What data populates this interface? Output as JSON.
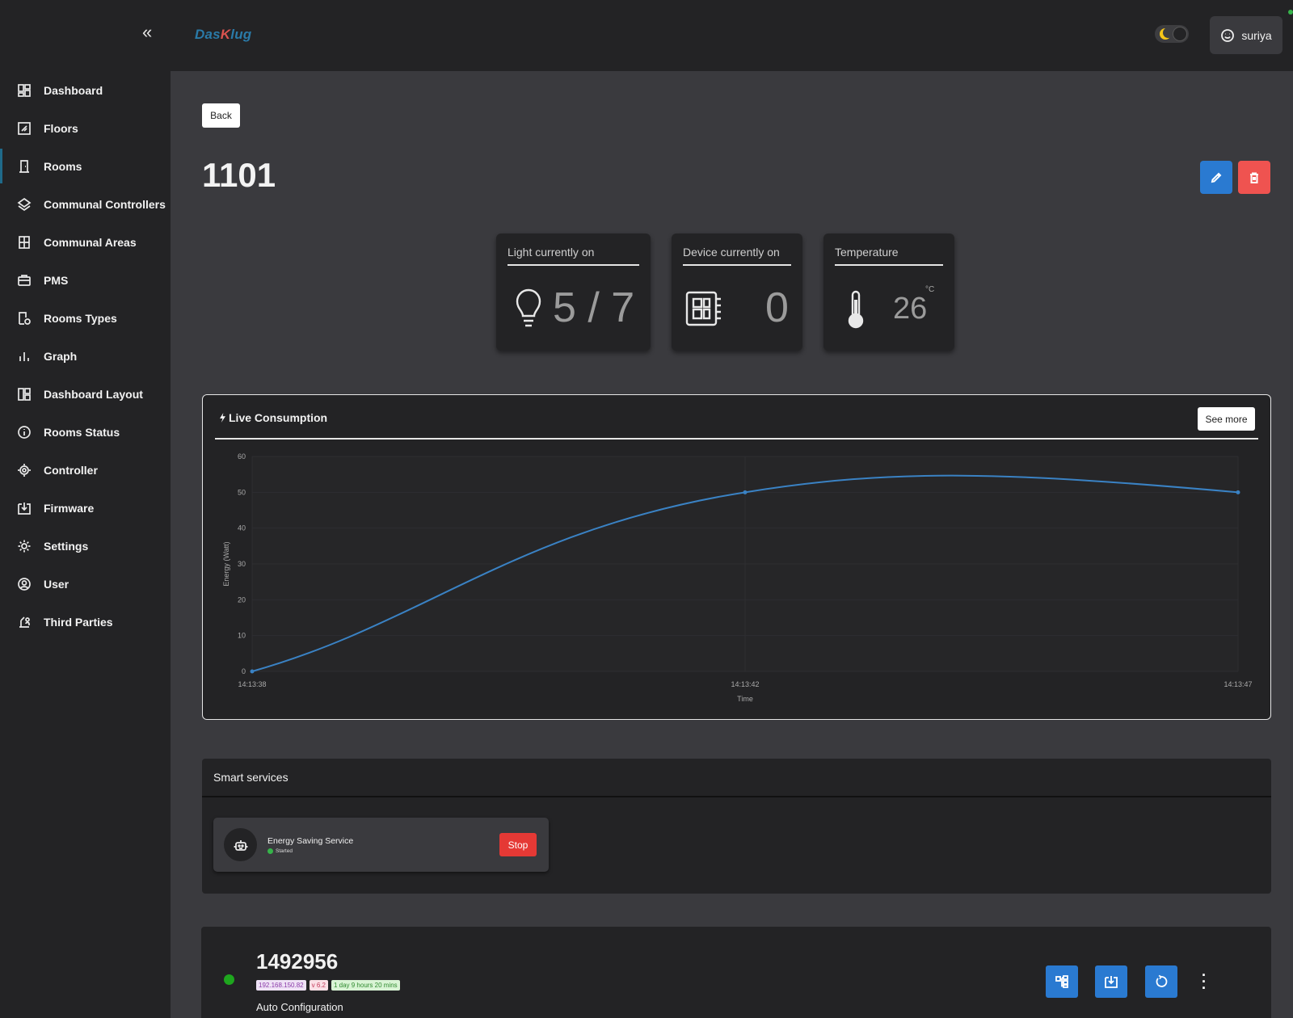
{
  "app": {
    "logo_main": "Das",
    "logo_k": "K",
    "logo_rest": "lug",
    "user_name": "suriya"
  },
  "sidebar": {
    "items": [
      {
        "label": "Dashboard",
        "icon": "dashboard-icon"
      },
      {
        "label": "Floors",
        "icon": "floors-icon"
      },
      {
        "label": "Rooms",
        "icon": "door-icon",
        "active": true
      },
      {
        "label": "Communal Controllers",
        "icon": "layers-icon"
      },
      {
        "label": "Communal Areas",
        "icon": "building-icon"
      },
      {
        "label": "PMS",
        "icon": "briefcase-icon"
      },
      {
        "label": "Rooms Types",
        "icon": "room-types-icon"
      },
      {
        "label": "Graph",
        "icon": "bar-chart-icon"
      },
      {
        "label": "Dashboard Layout",
        "icon": "layout-icon"
      },
      {
        "label": "Rooms Status",
        "icon": "info-icon"
      },
      {
        "label": "Controller",
        "icon": "chip-icon"
      },
      {
        "label": "Firmware",
        "icon": "download-icon"
      },
      {
        "label": "Settings",
        "icon": "gear-icon"
      },
      {
        "label": "User",
        "icon": "user-icon"
      },
      {
        "label": "Third Parties",
        "icon": "third-parties-icon"
      }
    ]
  },
  "main": {
    "back_label": "Back",
    "room_title": "1101",
    "stats": {
      "light": {
        "title": "Light currently on",
        "value": "5 / 7"
      },
      "device": {
        "title": "Device currently on",
        "value": "0"
      },
      "temperature": {
        "title": "Temperature",
        "value": "26",
        "unit": "°C"
      }
    },
    "chart_panel": {
      "title": "Live Consumption",
      "see_more": "See more"
    },
    "services": {
      "title": "Smart services",
      "items": [
        {
          "name": "Energy Saving Service",
          "status": "Started",
          "action": "Stop"
        }
      ]
    },
    "controller": {
      "id": "1492956",
      "ip": "192.168.150.82",
      "version": "v 6.2",
      "uptime": "1 day 9 hours 20 mins",
      "description": "Auto Configuration"
    }
  },
  "colors": {
    "accent": "#2a7ad1",
    "danger": "#ef5350",
    "line": "#3a82c4",
    "online": "#1ea61e"
  },
  "chart_data": {
    "type": "line",
    "x": [
      "14:13:38",
      "14:13:42",
      "14:13:47"
    ],
    "values": [
      0,
      50,
      50
    ],
    "series": [
      {
        "values": [
          0,
          50,
          50
        ]
      }
    ],
    "xlabel": "Time",
    "ylabel": "Energy (Watt)",
    "ylim": [
      0,
      60
    ],
    "yticks": [
      0,
      10,
      20,
      30,
      40,
      50,
      60
    ],
    "grid": true
  }
}
